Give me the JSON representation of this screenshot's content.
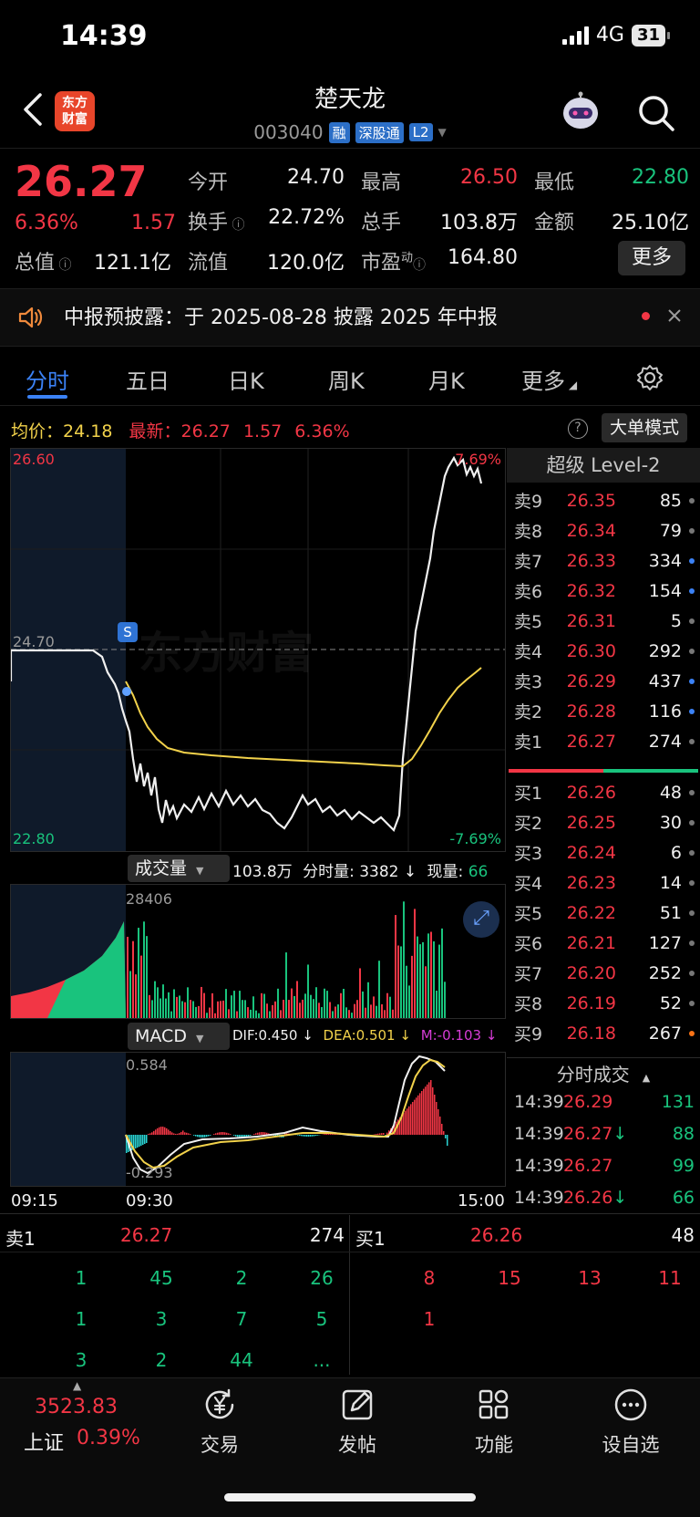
{
  "status": {
    "time": "14:39",
    "network": "4G",
    "battery": "31"
  },
  "header": {
    "title": "楚天龙",
    "code": "003040",
    "tags": [
      "融",
      "深股通",
      "L2"
    ],
    "logo_line1": "东方",
    "logo_line2": "财富"
  },
  "quote": {
    "price": "26.27",
    "change_pct": "6.36%",
    "change": "1.57",
    "open_label": "今开",
    "open": "24.70",
    "high_label": "最高",
    "high": "26.50",
    "low_label": "最低",
    "low": "22.80",
    "turnover_label": "换手",
    "turnover": "22.72%",
    "volume_label": "总手",
    "volume": "103.8万",
    "amount_label": "金额",
    "amount": "25.10亿",
    "mktcap_label": "总值",
    "mktcap": "121.1亿",
    "float_label": "流值",
    "float": "120.0亿",
    "pe_label": "市盈",
    "pe_sup": "动",
    "pe": "164.80",
    "more": "更多"
  },
  "notice": {
    "text": "中报预披露：于 2025-08-28 披露 2025 年中报"
  },
  "tabs": [
    "分时",
    "五日",
    "日K",
    "周K",
    "月K",
    "更多"
  ],
  "info_row": {
    "avg_label": "均价：",
    "avg": "24.18",
    "latest_label": "最新：",
    "latest": "26.27",
    "change": "1.57",
    "pct": "6.36%",
    "help": "?",
    "bigorder": "大单模式"
  },
  "intraday": {
    "y_high": "26.60",
    "y_low": "22.80",
    "pct_high": "7.69%",
    "pct_low": "-7.69%",
    "prev_close_label": "24.70",
    "watermark": "东方财富",
    "marker": "S"
  },
  "volume_panel": {
    "selector": "成交量",
    "total": "103.8万",
    "minute_label": "分时量:",
    "minute": "3382",
    "now_label": "现量:",
    "now": "66",
    "max": "28406"
  },
  "macd_panel": {
    "selector": "MACD",
    "dif": "DIF:0.450",
    "dea": "DEA:0.501",
    "m": "M:-0.103",
    "top": "0.584",
    "bottom": "-0.293"
  },
  "time_axis": {
    "start": "09:15",
    "open": "09:30",
    "close": "15:00"
  },
  "level2_title": "超级 Level-2",
  "asks": [
    {
      "label": "卖9",
      "price": "26.35",
      "vol": "85",
      "dot": "#777777"
    },
    {
      "label": "卖8",
      "price": "26.34",
      "vol": "79",
      "dot": "#777777"
    },
    {
      "label": "卖7",
      "price": "26.33",
      "vol": "334",
      "dot": "#3b82f6"
    },
    {
      "label": "卖6",
      "price": "26.32",
      "vol": "154",
      "dot": "#3b82f6"
    },
    {
      "label": "卖5",
      "price": "26.31",
      "vol": "5",
      "dot": "#777777"
    },
    {
      "label": "卖4",
      "price": "26.30",
      "vol": "292",
      "dot": "#777777"
    },
    {
      "label": "卖3",
      "price": "26.29",
      "vol": "437",
      "dot": "#3b82f6"
    },
    {
      "label": "卖2",
      "price": "26.28",
      "vol": "116",
      "dot": "#3b82f6"
    },
    {
      "label": "卖1",
      "price": "26.27",
      "vol": "274",
      "dot": "#777777"
    }
  ],
  "bids": [
    {
      "label": "买1",
      "price": "26.26",
      "vol": "48",
      "dot": "#777777"
    },
    {
      "label": "买2",
      "price": "26.25",
      "vol": "30",
      "dot": "#777777"
    },
    {
      "label": "买3",
      "price": "26.24",
      "vol": "6",
      "dot": "#777777"
    },
    {
      "label": "买4",
      "price": "26.23",
      "vol": "14",
      "dot": "#777777"
    },
    {
      "label": "买5",
      "price": "26.22",
      "vol": "51",
      "dot": "#777777"
    },
    {
      "label": "买6",
      "price": "26.21",
      "vol": "127",
      "dot": "#777777"
    },
    {
      "label": "买7",
      "price": "26.20",
      "vol": "252",
      "dot": "#777777"
    },
    {
      "label": "买8",
      "price": "26.19",
      "vol": "52",
      "dot": "#777777"
    },
    {
      "label": "买9",
      "price": "26.18",
      "vol": "267",
      "dot": "#f97316"
    }
  ],
  "ticks_title": "分时成交",
  "ticks": [
    {
      "time": "14:39",
      "price": "26.29",
      "arrow": "",
      "vol": "131",
      "vol_color": "green"
    },
    {
      "time": "14:39",
      "price": "26.27",
      "arrow": "↓",
      "vol": "88",
      "vol_color": "green"
    },
    {
      "time": "14:39",
      "price": "26.27",
      "arrow": "",
      "vol": "99",
      "vol_color": "green"
    },
    {
      "time": "14:39",
      "price": "26.26",
      "arrow": "↓",
      "vol": "66",
      "vol_color": "green"
    }
  ],
  "queue": {
    "ask_label": "卖1",
    "ask_price": "26.27",
    "ask_vol": "274",
    "bid_label": "买1",
    "bid_price": "26.26",
    "bid_vol": "48",
    "ask_rows": [
      [
        "1",
        "45",
        "2",
        "26"
      ],
      [
        "1",
        "3",
        "7",
        "5"
      ],
      [
        "3",
        "2",
        "44",
        "..."
      ]
    ],
    "bid_rows": [
      [
        "8",
        "15",
        "13",
        "11"
      ],
      [
        "1"
      ]
    ]
  },
  "bottom_nav": {
    "index_value": "3523.83",
    "index_name": "上证",
    "index_pct": "0.39%",
    "items": [
      "交易",
      "发帖",
      "功能",
      "设自选"
    ]
  }
}
